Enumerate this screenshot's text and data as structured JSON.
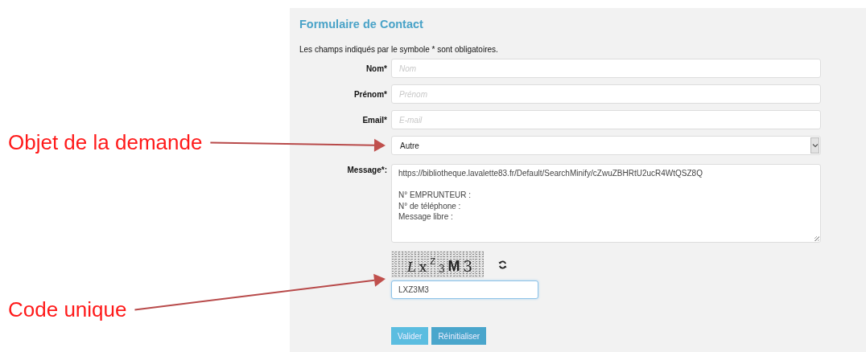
{
  "form": {
    "title": "Formulaire de Contact",
    "note": "Les champs indiqués par le symbole * sont obligatoires.",
    "fields": [
      {
        "kind": "text",
        "label": "Nom*",
        "placeholder": "Nom"
      },
      {
        "kind": "text",
        "label": "Prénom*",
        "placeholder": "Prénom"
      },
      {
        "kind": "text",
        "label": "Email*",
        "placeholder": "E-mail"
      },
      {
        "kind": "select",
        "value": "Autre",
        "annotation": "Objet de la demande"
      },
      {
        "kind": "textarea",
        "label": "Message*:",
        "value": "https://bibliotheque.lavalette83.fr/Default/SearchMinify/cZwuZBHRtU2ucR4WtQSZ8Q\n\nN° EMPRUNTEUR :\nN° de téléphone :\nMessage libre :"
      }
    ],
    "captcha": {
      "annotation": "Code unique",
      "characters": [
        "L",
        "x",
        "Z",
        "3",
        "M",
        "3"
      ],
      "code": {
        "value": "LXZ3M3",
        "focused": true
      }
    },
    "buttons": [
      {
        "label": "Valider",
        "kind": "primary"
      },
      {
        "label": "Réinitialiser",
        "kind": "secondary"
      }
    ]
  }
}
